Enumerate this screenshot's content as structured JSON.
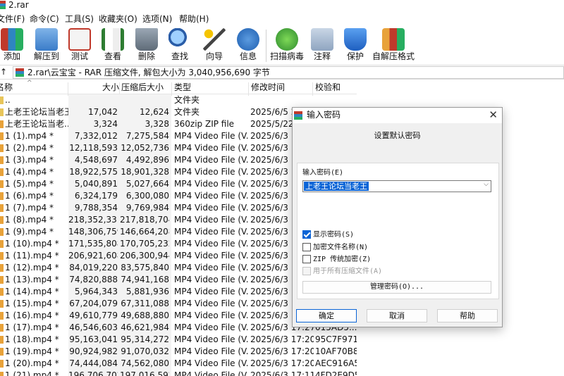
{
  "window": {
    "title": "2.rar"
  },
  "menu": [
    "文件(F)",
    "命令(C)",
    "工具(S)",
    "收藏夹(O)",
    "选项(N)",
    "帮助(H)"
  ],
  "toolbar": [
    {
      "label": "添加",
      "icon": "add-books-icon"
    },
    {
      "label": "解压到",
      "icon": "extract-folder-icon"
    },
    {
      "label": "测试",
      "icon": "test-clipboard-icon"
    },
    {
      "label": "查看",
      "icon": "view-book-icon"
    },
    {
      "label": "删除",
      "icon": "trash-icon"
    },
    {
      "label": "查找",
      "icon": "magnifier-icon"
    },
    {
      "label": "向导",
      "icon": "wand-icon"
    },
    {
      "label": "信息",
      "icon": "info-icon"
    },
    {
      "label": "扫描病毒",
      "icon": "virus-scan-icon"
    },
    {
      "label": "注释",
      "icon": "comment-icon"
    },
    {
      "label": "保护",
      "icon": "shield-icon"
    },
    {
      "label": "自解压格式",
      "icon": "sfx-boxes-icon"
    }
  ],
  "address": {
    "path": "2.rar\\云宝宝 - RAR 压缩文件, 解包大小为 3,040,956,690 字节"
  },
  "columns": {
    "name": "名称",
    "size": "大小",
    "packed": "压缩后大小",
    "type": "类型",
    "modified": "修改时间",
    "crc": "校验和"
  },
  "files": [
    {
      "name": "..",
      "size": "",
      "packed": "",
      "type": "文件夹",
      "modified": "",
      "crc": ""
    },
    {
      "name": "上老王论坛当老王",
      "size": "17,042",
      "packed": "12,624",
      "type": "文件夹",
      "modified": "2025/6/5 2",
      "crc": ""
    },
    {
      "name": "上老王论坛当老...",
      "size": "3,324",
      "packed": "3,328",
      "type": "360zip ZIP file",
      "modified": "2025/5/22",
      "crc": ""
    },
    {
      "name": "1 (1).mp4 *",
      "size": "7,332,012",
      "packed": "7,275,584",
      "type": "MP4 Video File (V...",
      "modified": "2025/6/3 1",
      "crc": ""
    },
    {
      "name": "1 (2).mp4 *",
      "size": "12,118,593",
      "packed": "12,052,736",
      "type": "MP4 Video File (V...",
      "modified": "2025/6/3 1",
      "crc": ""
    },
    {
      "name": "1 (3).mp4 *",
      "size": "4,548,697",
      "packed": "4,492,896",
      "type": "MP4 Video File (V...",
      "modified": "2025/6/3 1",
      "crc": ""
    },
    {
      "name": "1 (4).mp4 *",
      "size": "18,922,575",
      "packed": "18,901,328",
      "type": "MP4 Video File (V...",
      "modified": "2025/6/3 1",
      "crc": ""
    },
    {
      "name": "1 (5).mp4 *",
      "size": "5,040,891",
      "packed": "5,027,664",
      "type": "MP4 Video File (V...",
      "modified": "2025/6/3 1",
      "crc": ""
    },
    {
      "name": "1 (6).mp4 *",
      "size": "6,324,179",
      "packed": "6,300,080",
      "type": "MP4 Video File (V...",
      "modified": "2025/6/3 1",
      "crc": ""
    },
    {
      "name": "1 (7).mp4 *",
      "size": "9,788,354",
      "packed": "9,769,984",
      "type": "MP4 Video File (V...",
      "modified": "2025/6/3 1",
      "crc": ""
    },
    {
      "name": "1 (8).mp4 *",
      "size": "218,352,331",
      "packed": "217,818,704",
      "type": "MP4 Video File (V...",
      "modified": "2025/6/3 1",
      "crc": ""
    },
    {
      "name": "1 (9).mp4 *",
      "size": "148,306,759",
      "packed": "146,664,208",
      "type": "MP4 Video File (V...",
      "modified": "2025/6/3 1",
      "crc": ""
    },
    {
      "name": "1 (10).mp4 *",
      "size": "171,535,808",
      "packed": "170,705,232",
      "type": "MP4 Video File (V...",
      "modified": "2025/6/3 1",
      "crc": ""
    },
    {
      "name": "1 (11).mp4 *",
      "size": "206,921,608",
      "packed": "206,300,944",
      "type": "MP4 Video File (V...",
      "modified": "2025/6/3 1",
      "crc": ""
    },
    {
      "name": "1 (12).mp4 *",
      "size": "84,019,220",
      "packed": "83,575,840",
      "type": "MP4 Video File (V...",
      "modified": "2025/6/3 1",
      "crc": ""
    },
    {
      "name": "1 (13).mp4 *",
      "size": "74,820,888",
      "packed": "74,941,168",
      "type": "MP4 Video File (V...",
      "modified": "2025/6/3 1",
      "crc": ""
    },
    {
      "name": "1 (14).mp4 *",
      "size": "5,964,343",
      "packed": "5,881,936",
      "type": "MP4 Video File (V...",
      "modified": "2025/6/3 1",
      "crc": ""
    },
    {
      "name": "1 (15).mp4 *",
      "size": "67,204,079",
      "packed": "67,311,088",
      "type": "MP4 Video File (V...",
      "modified": "2025/6/3 1",
      "crc": ""
    },
    {
      "name": "1 (16).mp4 *",
      "size": "49,610,779",
      "packed": "49,688,880",
      "type": "MP4 Video File (V...",
      "modified": "2025/6/3 1",
      "crc": ""
    },
    {
      "name": "1 (17).mp4 *",
      "size": "46,546,603",
      "packed": "46,621,984",
      "type": "MP4 Video File (V...",
      "modified": "2025/6/3 17:27",
      "crc": "015AD5..."
    },
    {
      "name": "1 (18).mp4 *",
      "size": "95,163,041",
      "packed": "95,314,272",
      "type": "MP4 Video File (V...",
      "modified": "2025/6/3 17:20",
      "crc": "95C7F971"
    },
    {
      "name": "1 (19).mp4 *",
      "size": "90,924,982",
      "packed": "91,070,032",
      "type": "MP4 Video File (V...",
      "modified": "2025/6/3 17:20",
      "crc": "10AF70B8"
    },
    {
      "name": "1 (20).mp4 *",
      "size": "74,444,084",
      "packed": "74,562,080",
      "type": "MP4 Video File (V...",
      "modified": "2025/6/3 17:20",
      "crc": "AEC916A5"
    },
    {
      "name": "1 (21).mp4 *",
      "size": "196,706,702",
      "packed": "197,016,592",
      "type": "MP4 Video File (V...",
      "modified": "2025/6/3 17:11",
      "crc": "4FD2E9D5"
    }
  ],
  "dialog": {
    "title": "输入密码",
    "tab": "设置默认密码",
    "password_label": "输入密码(E)",
    "password_value": "上老王论坛当老王",
    "checkboxes": [
      {
        "label": "显示密码(S)",
        "checked": true,
        "enabled": true
      },
      {
        "label": "加密文件名称(N)",
        "checked": false,
        "enabled": true
      },
      {
        "label": "ZIP 传统加密(Z)",
        "checked": false,
        "enabled": true
      },
      {
        "label": "用于所有压缩文件(A)",
        "checked": false,
        "enabled": false
      }
    ],
    "manage_button": "管理密码(O)...",
    "ok": "确定",
    "cancel": "取消",
    "help": "帮助"
  }
}
